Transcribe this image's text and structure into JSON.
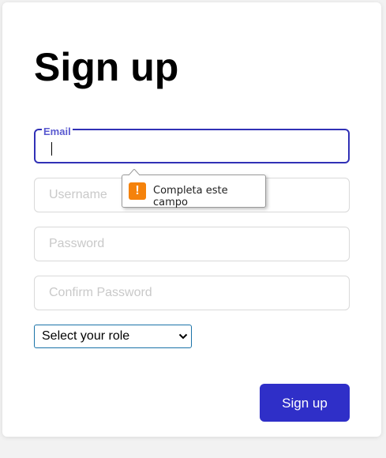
{
  "form": {
    "title": "Sign up",
    "email": {
      "label": "Email",
      "value": ""
    },
    "username": {
      "placeholder": "Username"
    },
    "password": {
      "placeholder": "Password"
    },
    "confirm_password": {
      "placeholder": "Confirm Password"
    },
    "role_select": {
      "selected": "Select your role"
    },
    "submit_label": "Sign up"
  },
  "validation_tooltip": {
    "icon": "warning-icon",
    "icon_glyph": "!",
    "message": "Completa este campo"
  },
  "colors": {
    "accent": "#2f2fc8",
    "focus_border": "#3131b6",
    "warning": "#f5820b"
  }
}
